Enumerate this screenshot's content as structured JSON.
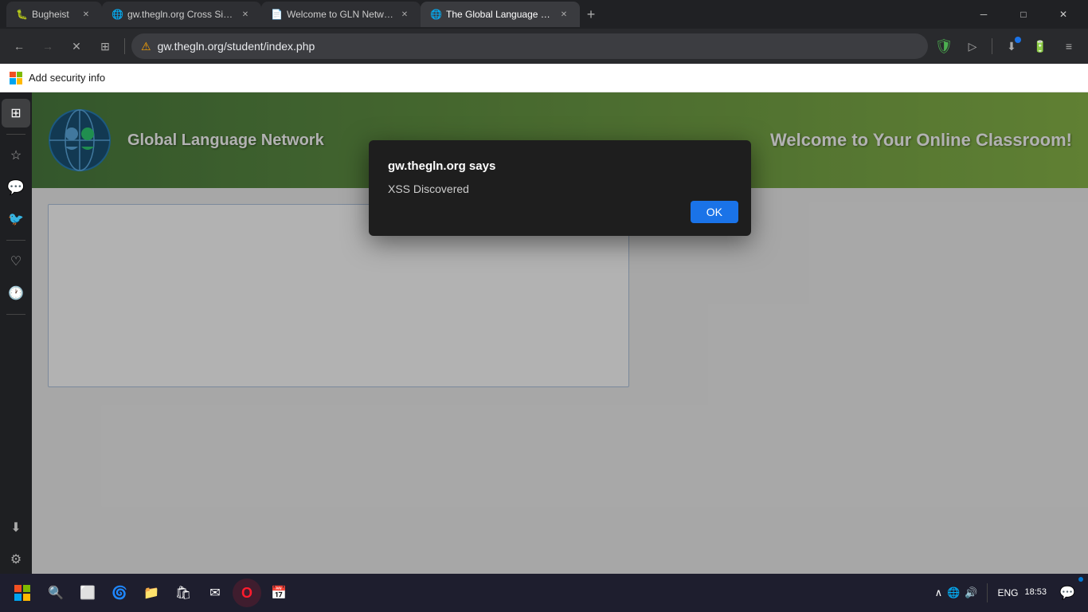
{
  "browser": {
    "title_bar": {
      "tabs": [
        {
          "id": "tab1",
          "label": "Bugheist",
          "active": false,
          "favicon": "🐛"
        },
        {
          "id": "tab2",
          "label": "gw.thegln.org Cross Site Sc...",
          "active": false,
          "favicon": "🌐"
        },
        {
          "id": "tab3",
          "label": "Welcome to GLN Network...",
          "active": false,
          "favicon": "📄"
        },
        {
          "id": "tab4",
          "label": "The Global Language Netw...",
          "active": true,
          "favicon": "🌐"
        }
      ],
      "new_tab_label": "+",
      "window_controls": {
        "minimize": "─",
        "maximize": "□",
        "close": "✕"
      }
    },
    "address_bar": {
      "back_label": "←",
      "forward_label": "→",
      "refresh_label": "✕",
      "url": "gw.thegln.org/student/index.php",
      "warning_icon": "⚠",
      "search_icon": "🔍",
      "shield_icon": "🛡",
      "extension_icon": "▷",
      "divider": "|",
      "download_icon": "⬇",
      "battery_icon": "🔋",
      "menu_icon": "≡"
    },
    "security_bar": {
      "add_security_label": "Add security info"
    }
  },
  "sidebar": {
    "items": [
      {
        "id": "home",
        "icon": "⊞",
        "label": "Home",
        "active": true
      },
      {
        "id": "bookmarks",
        "icon": "☆",
        "label": "Bookmarks",
        "active": false
      },
      {
        "id": "whatsapp",
        "icon": "💬",
        "label": "WhatsApp",
        "active": false
      },
      {
        "id": "twitter",
        "icon": "🐦",
        "label": "Twitter",
        "active": false
      },
      {
        "id": "favorites",
        "icon": "♡",
        "label": "Favorites",
        "active": false
      },
      {
        "id": "history",
        "icon": "🕐",
        "label": "History",
        "active": false
      },
      {
        "id": "downloads",
        "icon": "⬇",
        "label": "Downloads",
        "active": false
      },
      {
        "id": "settings",
        "icon": "⚙",
        "label": "Settings",
        "active": false
      }
    ]
  },
  "alert": {
    "title": "gw.thegln.org says",
    "message": "XSS Discovered",
    "ok_label": "OK"
  },
  "gln_banner": {
    "site_name": "Global Language Network",
    "welcome_text": "Welcome to Your Online Classroom!"
  },
  "taskbar": {
    "start_icon": "⊞",
    "search_icon": "🔍",
    "task_view_icon": "⬜",
    "edge_icon": "🌀",
    "explorer_icon": "📁",
    "store_icon": "🛍",
    "mail_icon": "✉",
    "opera_icon": "O",
    "calendar_icon": "📅",
    "sys_tray": {
      "up_arrow": "∧",
      "network_icon": "🌐",
      "volume_icon": "🔊",
      "lang": "ENG",
      "time": "18:53",
      "notification_icon": "💬"
    }
  }
}
